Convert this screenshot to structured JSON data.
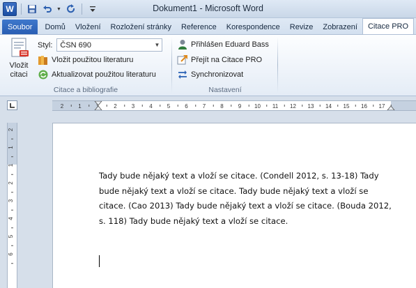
{
  "app": {
    "window_title": "Dokument1  -  Microsoft Word",
    "logo_letter": "W"
  },
  "tabs": [
    {
      "label": "Soubor"
    },
    {
      "label": "Domů"
    },
    {
      "label": "Vložení"
    },
    {
      "label": "Rozložení stránky"
    },
    {
      "label": "Reference"
    },
    {
      "label": "Korespondence"
    },
    {
      "label": "Revize"
    },
    {
      "label": "Zobrazení"
    },
    {
      "label": "Citace PRO"
    }
  ],
  "ribbon": {
    "citations_group": {
      "insert_citation_label_line1": "Vložit",
      "insert_citation_label_line2": "citaci",
      "style_label": "Styl:",
      "style_value": "ČSN 690",
      "insert_bibliography": "Vložit použitou literaturu",
      "update_bibliography": "Aktualizovat použitou literaturu",
      "group_label": "Citace a bibliografie"
    },
    "settings_group": {
      "logged_in": "Přihlášen Eduard Bass",
      "go_to_citace": "Přejít na Citace PRO",
      "sync": "Synchronizovat",
      "group_label": "Nastavení"
    }
  },
  "ruler": {
    "h_labels": [
      "2",
      "1",
      "1",
      "2",
      "3",
      "4",
      "5",
      "6",
      "7",
      "8",
      "9",
      "10",
      "11",
      "12",
      "13",
      "14",
      "15",
      "16",
      "17"
    ],
    "v_labels": [
      "2",
      "1",
      "1",
      "2",
      "3",
      "4",
      "5",
      "6"
    ]
  },
  "document": {
    "paragraph": "Tady bude nějaký text a vloží se citace. (Condell 2012, s. 13-18) Tady bude nějaký text a vloží se citace. Tady bude nějaký text a vloží se citace. (Cao 2013) Tady bude nějaký text a vloží se citace. (Bouda 2012, s. 118) Tady bude nějaký text a vloží se citace."
  },
  "colors": {
    "file_tab": "#2a5eb3",
    "ribbon_bg": "#e4ecf6",
    "workspace_bg": "#d6dfea"
  }
}
